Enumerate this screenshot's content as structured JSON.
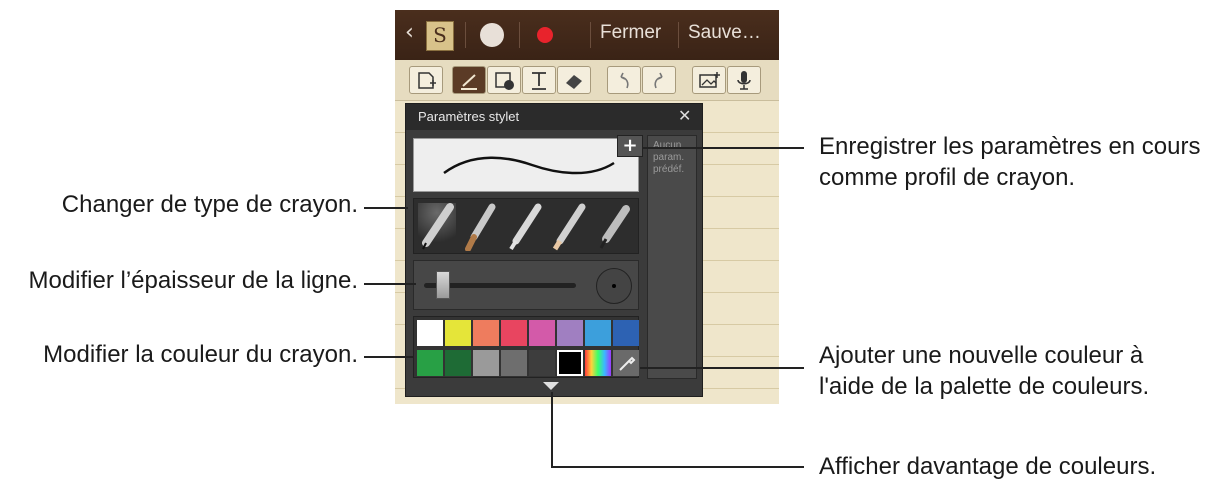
{
  "app": {
    "topbar": {
      "close_label": "Fermer",
      "save_label": "Sauve…"
    }
  },
  "panel": {
    "title": "Paramètres stylet",
    "preset_text": "Aucun param. prédéf.",
    "add_preset_symbol": "+"
  },
  "palette": {
    "row1": [
      "#ffffff",
      "#e5e539",
      "#ee7c5e",
      "#e84560",
      "#d35aa9",
      "#a07fc1",
      "#3c9fdc",
      "#2d62b3"
    ],
    "row2": [
      "#28a045",
      "#1e6b35",
      "#9a9a9a",
      "#6e6e6e",
      "#3d3d3d",
      "#000000"
    ],
    "selected": "#000000"
  },
  "callouts": {
    "pen_type": "Changer de type de crayon.",
    "thickness": "Modifier l’épaisseur de la ligne.",
    "color": "Modifier la couleur du crayon.",
    "save_profile_line1": "Enregistrer les paramètres en cours",
    "save_profile_line2": "comme profil de crayon.",
    "add_color_line1": "Ajouter une nouvelle couleur à",
    "add_color_line2": "l'aide de la palette de couleurs.",
    "more_colors": "Afficher davantage de couleurs."
  }
}
